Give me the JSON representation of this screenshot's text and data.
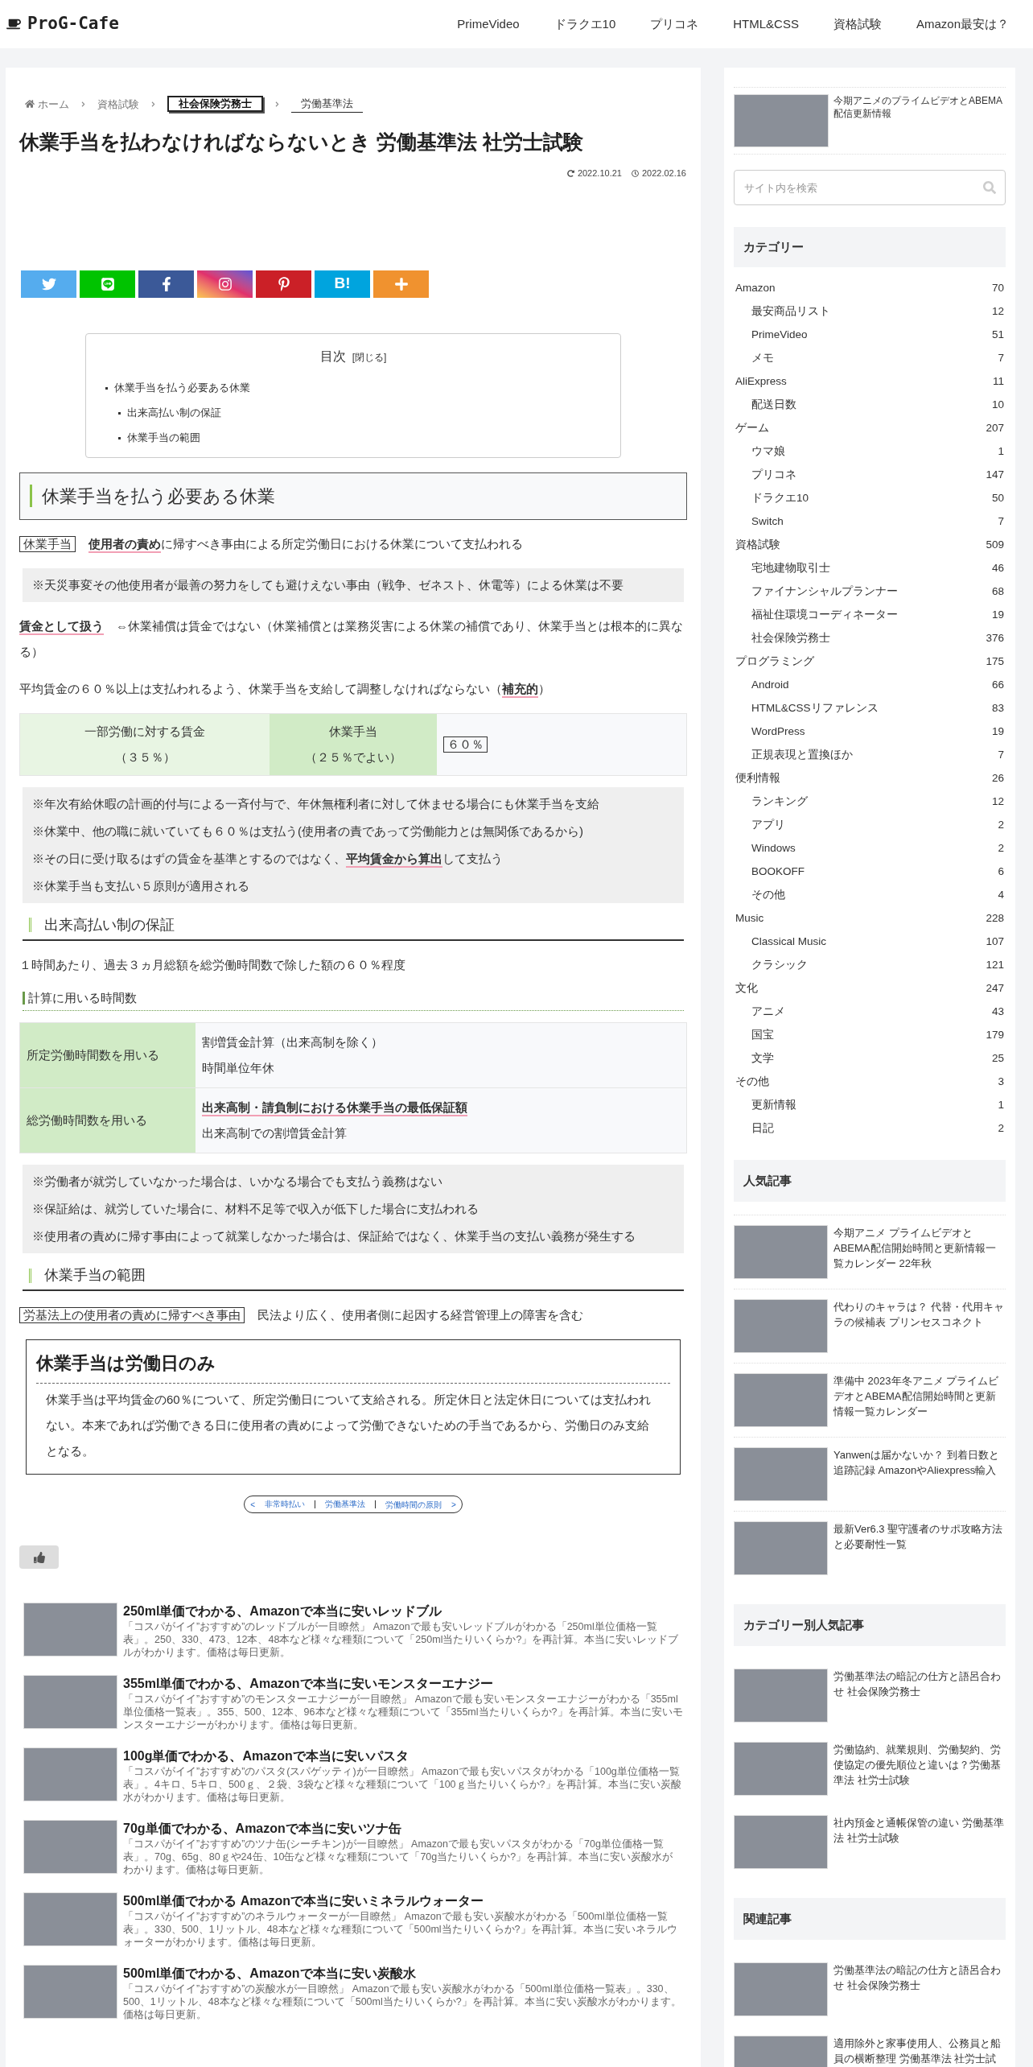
{
  "header": {
    "logo": "ProG-Cafe",
    "nav": [
      "PrimeVideo",
      "ドラクエ10",
      "プリコネ",
      "HTML&CSS",
      "資格試験",
      "Amazon最安は？"
    ]
  },
  "breadcrumbs": [
    {
      "label": "ホーム",
      "kind": "home"
    },
    {
      "label": "資格試験",
      "kind": "plain"
    },
    {
      "label": "社会保険労務士",
      "kind": "boxed"
    },
    {
      "label": "労働基準法",
      "kind": "underlined"
    }
  ],
  "article": {
    "title": "休業手当を払わなければならないとき 労働基準法 社労士試験",
    "updated": "2022.10.21",
    "published": "2022.02.16",
    "share": [
      {
        "kind": "twitter"
      },
      {
        "kind": "line"
      },
      {
        "kind": "facebook"
      },
      {
        "kind": "instagram"
      },
      {
        "kind": "pinterest"
      },
      {
        "kind": "hatena",
        "label": "B!"
      },
      {
        "kind": "more"
      }
    ],
    "toc": {
      "title": "目次",
      "toggle": "[閉じる]",
      "items": [
        {
          "label": "休業手当を払う必要ある休業",
          "children": [
            {
              "label": "出来高払い制の保証"
            },
            {
              "label": "休業手当の範囲"
            }
          ]
        }
      ]
    },
    "blocks": [
      {
        "kind": "h2",
        "text": "休業手当を払う必要ある休業"
      },
      {
        "kind": "para",
        "term": "休業手当",
        "text": "**使用者の責め**に帰すべき事由による所定労働日における休業について支払われる"
      },
      {
        "kind": "notes",
        "lines": [
          "※天災事変その他使用者が最善の努力をしても避けえない事由（戦争、ゼネスト、休電等）による休業は不要"
        ]
      },
      {
        "kind": "para",
        "text": "**賃金として扱う**　⇔休業補償は賃金ではない（休業補償とは業務災害による休業の補償であり、休業手当とは根本的に異なる）"
      },
      {
        "kind": "para",
        "text": "平均賃金の６０％以上は支払われるよう、休業手当を支給して調整しなければならない（**補充的**）"
      },
      {
        "kind": "split",
        "cells": [
          {
            "kind": "light",
            "lines": [
              "一部労働に対する賃金",
              "（３５％）"
            ]
          },
          {
            "kind": "green",
            "lines": [
              "休業手当",
              "（２５％でよい）"
            ]
          },
          {
            "kind": "boxed",
            "lines": [
              "６０％"
            ]
          }
        ]
      },
      {
        "kind": "notes",
        "lines": [
          "※年次有給休暇の計画的付与による一斉付与で、年休無権利者に対して休ませる場合にも休業手当を支給",
          "※休業中、他の職に就いていても６０％は支払う(使用者の責であって労働能力とは無関係であるから)",
          "※その日に受け取るはずの賃金を基準とするのではなく、**平均賃金から算出**して支払う",
          "※休業手当も支払い５原則が適用される"
        ]
      },
      {
        "kind": "h3",
        "text": "出来高払い制の保証"
      },
      {
        "kind": "para",
        "text": "１時間あたり、過去３ヵ月総額を総労働時間数で除した額の６０％程度"
      },
      {
        "kind": "h4",
        "text": "計算に用いる時間数"
      },
      {
        "kind": "table",
        "rows": [
          {
            "head": "所定労働時間数を用いる",
            "lines": [
              "割増賃金計算（出来高制を除く）",
              "時間単位年休"
            ]
          },
          {
            "head": "総労働時間数を用いる",
            "lines": [
              "**出来高制・請負制における休業手当の最低保証額**",
              "出来高制での割増賃金計算"
            ]
          }
        ]
      },
      {
        "kind": "notes",
        "lines": [
          "※労働者が就労していなかった場合は、いかなる場合でも支払う義務はない",
          "※保証給は、就労していた場合に、材料不足等で収入が低下した場合に支払われる",
          "※使用者の責めに帰す事由によって就業しなかった場合は、保証給ではなく、休業手当の支払い義務が発生する"
        ]
      },
      {
        "kind": "h3",
        "text": "休業手当の範囲"
      },
      {
        "kind": "para",
        "term": "労基法上の使用者の責めに帰すべき事由",
        "text": "民法より広く、使用者側に起因する経営管理上の障害を含む"
      },
      {
        "kind": "box",
        "title": "休業手当は労働日のみ",
        "text": "休業手当は平均賃金の60％について、所定労働日について支給される。所定休日と法定休日については支払われない。本来であれば労働できる日に使用者の責めによって労働できないための手当であるから、労働日のみ支給となる。"
      }
    ],
    "pager": {
      "prev_mark": "<",
      "prev": "非常時払い",
      "middle": "労働基準法",
      "next": "労働時間の原則",
      "next_mark": ">"
    },
    "related": [
      {
        "title": "250ml単価でわかる、Amazonで本当に安いレッドブル",
        "excerpt": "「コスパがイイ”おすすめ”のレッドブルが一目瞭然」 Amazonで最も安いレッドブルがわかる「250ml単位価格一覧表」。250、330、473、12本、48本など様々な種類について「250ml当たりいくらか?」を再計算。本当に安いレッドブルがわかります。価格は毎日更新。"
      },
      {
        "title": "355ml単価でわかる、Amazonで本当に安いモンスターエナジー",
        "excerpt": "「コスパがイイ”おすすめ”のモンスターエナジーが一目瞭然」 Amazonで最も安いモンスターエナジーがわかる「355ml単位価格一覧表」。355、500、12本、96本など様々な種類について「355ml当たりいくらか?」を再計算。本当に安いモンスターエナジーがわかります。価格は毎日更新。"
      },
      {
        "title": "100g単価でわかる、Amazonで本当に安いパスタ",
        "excerpt": "「コスパがイイ”おすすめ”のパスタ(スパゲッティ)が一目瞭然」 Amazonで最も安いパスタがわかる「100g単位価格一覧表」。4キロ、5キロ、500ｇ、２袋、3袋など様々な種類について「100ｇ当たりいくらか?」を再計算。本当に安い炭酸水がわかります。価格は毎日更新。"
      },
      {
        "title": "70g単価でわかる、Amazonで本当に安いツナ缶",
        "excerpt": "「コスパがイイ”おすすめ”のツナ缶(シーチキン)が一目瞭然」 Amazonで最も安いパスタがわかる「70g単位価格一覧表」。70g、65g、80ｇや24缶、10缶など様々な種類について「70g当たりいくらか?」を再計算。本当に安い炭酸水がわかります。価格は毎日更新。"
      },
      {
        "title": "500ml単価でわかる Amazonで本当に安いミネラルウォーター",
        "excerpt": "「コスパがイイ”おすすめ”のネラルウォーターが一目瞭然」 Amazonで最も安い炭酸水がわかる「500ml単位価格一覧表」。330、500、1リットル、48本など様々な種類について「500ml当たりいくらか?」を再計算。本当に安いネラルウォーターがわかります。価格は毎日更新。"
      },
      {
        "title": "500ml単価でわかる、Amazonで本当に安い炭酸水",
        "excerpt": "「コスパがイイ”おすすめ”の炭酸水が一目瞭然」 Amazonで最も安い炭酸水がわかる「500ml単位価格一覧表」。330、500、1リットル、48本など様々な種類について「500ml当たりいくらか?」を再計算。本当に安い炭酸水がわかります。価格は毎日更新。"
      }
    ]
  },
  "sidebar": {
    "top_post": "今期アニメのプライムビデオとABEMA配信更新情報",
    "search": {
      "placeholder": "サイト内を検索"
    },
    "categories": {
      "title": "カテゴリー",
      "items": [
        {
          "name": "Amazon",
          "count": "70",
          "children": [
            {
              "name": "最安商品リスト",
              "count": "12"
            },
            {
              "name": "PrimeVideo",
              "count": "51"
            },
            {
              "name": "メモ",
              "count": "7"
            }
          ]
        },
        {
          "name": "AliExpress",
          "count": "11",
          "children": [
            {
              "name": "配送日数",
              "count": "10"
            }
          ]
        },
        {
          "name": "ゲーム",
          "count": "207",
          "children": [
            {
              "name": "ウマ娘",
              "count": "1"
            },
            {
              "name": "プリコネ",
              "count": "147"
            },
            {
              "name": "ドラクエ10",
              "count": "50"
            },
            {
              "name": "Switch",
              "count": "7"
            }
          ]
        },
        {
          "name": "資格試験",
          "count": "509",
          "children": [
            {
              "name": "宅地建物取引士",
              "count": "46"
            },
            {
              "name": "ファイナンシャルプランナー",
              "count": "68"
            },
            {
              "name": "福祉住環境コーディネーター",
              "count": "19"
            },
            {
              "name": "社会保険労務士",
              "count": "376"
            }
          ]
        },
        {
          "name": "プログラミング",
          "count": "175",
          "children": [
            {
              "name": "Android",
              "count": "66"
            },
            {
              "name": "HTML&CSSリファレンス",
              "count": "83"
            },
            {
              "name": "WordPress",
              "count": "19"
            },
            {
              "name": "正規表現と置換ほか",
              "count": "7"
            }
          ]
        },
        {
          "name": "便利情報",
          "count": "26",
          "children": [
            {
              "name": "ランキング",
              "count": "12"
            },
            {
              "name": "アプリ",
              "count": "2"
            },
            {
              "name": "Windows",
              "count": "2"
            },
            {
              "name": "BOOKOFF",
              "count": "6"
            },
            {
              "name": "その他",
              "count": "4"
            }
          ]
        },
        {
          "name": "Music",
          "count": "228",
          "children": [
            {
              "name": "Classical Music",
              "count": "107"
            },
            {
              "name": "クラシック",
              "count": "121"
            }
          ]
        },
        {
          "name": "文化",
          "count": "247",
          "children": [
            {
              "name": "アニメ",
              "count": "43"
            },
            {
              "name": "国宝",
              "count": "179"
            },
            {
              "name": "文学",
              "count": "25"
            }
          ]
        },
        {
          "name": "その他",
          "count": "3",
          "children": [
            {
              "name": "更新情報",
              "count": "1"
            },
            {
              "name": "日記",
              "count": "2"
            }
          ]
        }
      ]
    },
    "sections": [
      {
        "title": "人気記事",
        "posts": [
          "今期アニメ プライムビデオとABEMA配信開始時間と更新情報一覧カレンダー 22年秋",
          "代わりのキャラは？ 代替・代用キャラの候補表 プリンセスコネクト",
          "準備中 2023年冬アニメ プライムビデオとABEMA配信開始時間と更新情報一覧カレンダー",
          "Yanwenは届かないか？ 到着日数と追跡記録 AmazonやAliexpress輸入",
          "最新Ver6.3 聖守護者のサポ攻略方法と必要耐性一覧"
        ]
      },
      {
        "title": "カテゴリー別人気記事",
        "posts": [
          "労働基準法の暗記の仕方と語呂合わせ 社会保険労務士",
          "労働協約、就業規則、労働契約、労使協定の優先順位と違いは？労働基準法 社労士試験",
          "社内預金と通帳保管の違い 労働基準法 社労士試験"
        ]
      },
      {
        "title": "関連記事",
        "posts": [
          "労働基準法の暗記の仕方と語呂合わせ 社会保険労務士",
          "適用除外と家事使用人、公務員と船員の横断整理 労働基準法 社労士試"
        ]
      }
    ]
  }
}
